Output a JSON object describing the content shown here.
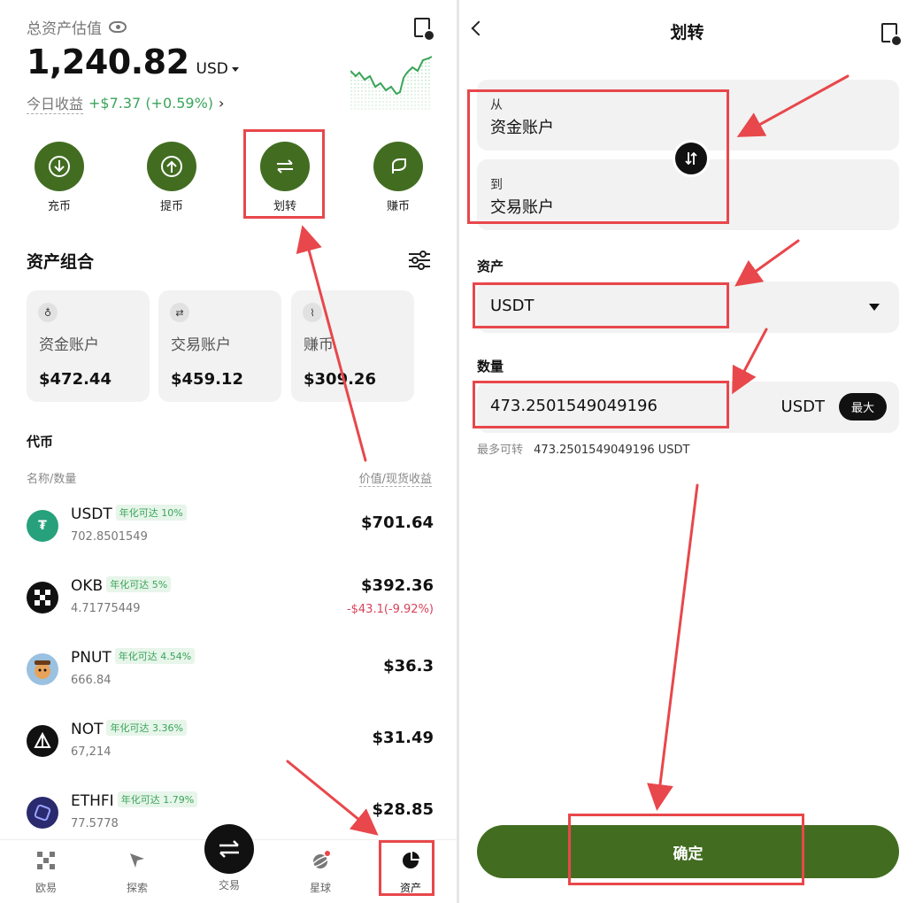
{
  "assets_screen": {
    "total_label": "总资产估值",
    "total_value": "1,240.82",
    "currency": "USD",
    "today_pnl_label": "今日收益",
    "today_pnl_value": "+$7.37 (+0.59%)",
    "actions": [
      {
        "label": "充币",
        "icon": "deposit-icon"
      },
      {
        "label": "提币",
        "icon": "withdraw-icon"
      },
      {
        "label": "划转",
        "icon": "transfer-icon"
      },
      {
        "label": "赚币",
        "icon": "earn-icon"
      }
    ],
    "portfolio_title": "资产组合",
    "accounts": [
      {
        "name": "资金账户",
        "amount": "$472.44",
        "icon": "wallet-icon"
      },
      {
        "name": "交易账户",
        "amount": "$459.12",
        "icon": "exchange-icon"
      },
      {
        "name": "赚币",
        "amount": "$309.26",
        "icon": "earn-icon"
      }
    ],
    "tokens_title": "代币",
    "col_left": "名称/数量",
    "col_right": "价值/现货收益",
    "coins": [
      {
        "symbol": "USDT",
        "badge": "年化可达 10%",
        "qty": "702.8501549",
        "value": "$701.64",
        "pnl": "",
        "color": "#26a17b",
        "glyph": "₮"
      },
      {
        "symbol": "OKB",
        "badge": "年化可达 5%",
        "qty": "4.71775449",
        "value": "$392.36",
        "pnl": "-$43.1(-9.92%)",
        "color": "#111111",
        "glyph": "▦"
      },
      {
        "symbol": "PNUT",
        "badge": "年化可达 4.54%",
        "qty": "666.84",
        "value": "$36.3",
        "pnl": "",
        "color": "#9bc1e0",
        "glyph": "🐿"
      },
      {
        "symbol": "NOT",
        "badge": "年化可达 3.36%",
        "qty": "67,214",
        "value": "$31.49",
        "pnl": "",
        "color": "#111111",
        "glyph": "▲"
      },
      {
        "symbol": "ETHFI",
        "badge": "年化可达 1.79%",
        "qty": "77.5778",
        "value": "$28.85",
        "pnl": "",
        "color": "#2a2a6e",
        "glyph": "◈"
      }
    ],
    "nav": [
      {
        "label": "欧易",
        "icon": "okx-logo-icon"
      },
      {
        "label": "探索",
        "icon": "compass-icon"
      },
      {
        "label": "交易",
        "icon": "trade-icon"
      },
      {
        "label": "星球",
        "icon": "planet-icon"
      },
      {
        "label": "资产",
        "icon": "pie-chart-icon"
      }
    ]
  },
  "transfer_screen": {
    "title": "划转",
    "from_label": "从",
    "from_value": "资金账户",
    "to_label": "到",
    "to_value": "交易账户",
    "asset_label": "资产",
    "asset_value": "USDT",
    "amount_label": "数量",
    "amount_value": "473.2501549049196",
    "amount_unit": "USDT",
    "max_label": "最大",
    "max_transfer_label": "最多可转",
    "max_transfer_value": "473.2501549049196 USDT",
    "confirm_label": "确定"
  },
  "colors": {
    "brand_green": "#426d21",
    "positive": "#3aa55a",
    "negative": "#d9425a",
    "annotation_red": "#e8474b"
  }
}
